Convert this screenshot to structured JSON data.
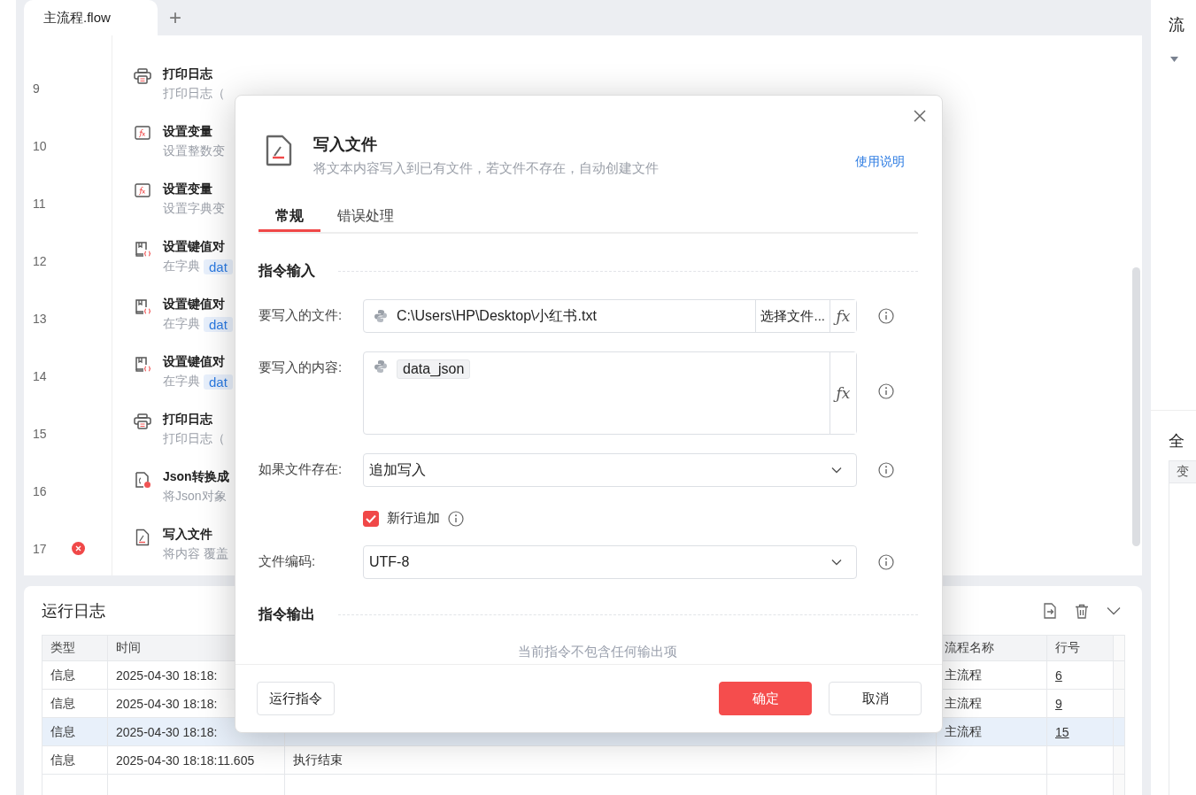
{
  "tabs": [
    {
      "label": "主流程.flow",
      "selected": true
    }
  ],
  "add_tab": "+",
  "flow_steps": [
    {
      "line": "9",
      "kind": "printer",
      "title": "打印日志",
      "desc": "打印日志（",
      "error": false
    },
    {
      "line": "10",
      "kind": "function",
      "title": "设置变量",
      "desc": "设置整数变",
      "error": false
    },
    {
      "line": "11",
      "kind": "function",
      "title": "设置变量",
      "desc": "设置字典变",
      "error": false
    },
    {
      "line": "12",
      "kind": "dict",
      "title": "设置键值对",
      "desc": "在字典",
      "chip": "dat",
      "error": false
    },
    {
      "line": "13",
      "kind": "dict",
      "title": "设置键值对",
      "desc": "在字典",
      "chip": "dat",
      "error": false
    },
    {
      "line": "14",
      "kind": "dict",
      "title": "设置键值对",
      "desc": "在字典",
      "chip": "dat",
      "error": false
    },
    {
      "line": "15",
      "kind": "printer",
      "title": "打印日志",
      "desc": "打印日志（",
      "error": false
    },
    {
      "line": "16",
      "kind": "json",
      "title": "Json转换成",
      "desc": "将Json对象",
      "error": false
    },
    {
      "line": "17",
      "kind": "file",
      "title": "写入文件",
      "desc": "将内容 覆盖",
      "error": true
    }
  ],
  "log": {
    "title": "运行日志",
    "columns": [
      "类型",
      "时间",
      "",
      "流程名称",
      "行号"
    ],
    "rows": [
      {
        "cells": [
          "信息",
          "2025-04-30 18:18:",
          "",
          "主流程",
          "6"
        ],
        "selected": false
      },
      {
        "cells": [
          "信息",
          "2025-04-30 18:18:",
          "",
          "主流程",
          "9"
        ],
        "selected": false
      },
      {
        "cells": [
          "信息",
          "2025-04-30 18:18:",
          "",
          "主流程",
          "15"
        ],
        "selected": true
      },
      {
        "cells": [
          "信息",
          "2025-04-30 18:18:11.605",
          "执行结束",
          "",
          ""
        ],
        "selected": false
      }
    ]
  },
  "right_panel": {
    "title": "流",
    "section": "全",
    "table_header": "变"
  },
  "dialog": {
    "title": "写入文件",
    "subtitle": "将文本内容写入到已有文件，若文件不存在，自动创建文件",
    "help_link": "使用说明",
    "tabs": [
      {
        "label": "常规",
        "selected": true
      },
      {
        "label": "错误处理",
        "selected": false
      }
    ],
    "input_section": "指令输入",
    "fields": [
      {
        "kind": "file",
        "label": "要写入的文件:",
        "value": "C:\\Users\\HP\\Desktop\\小红书.txt",
        "button": "选择文件...",
        "fx": "ƒx"
      },
      {
        "kind": "content",
        "label": "要写入的内容:",
        "chip": "data_json",
        "fx": "ƒx"
      },
      {
        "kind": "select",
        "label": "如果文件存在:",
        "value": "追加写入"
      },
      {
        "kind": "checkbox",
        "label": "新行追加",
        "checked": true
      },
      {
        "kind": "select",
        "label": "文件编码:",
        "value": "UTF-8"
      }
    ],
    "output_section": "指令输出",
    "output_empty": "当前指令不包含任何输出项",
    "buttons": {
      "run": "运行指令",
      "ok": "确定",
      "cancel": "取消"
    }
  }
}
